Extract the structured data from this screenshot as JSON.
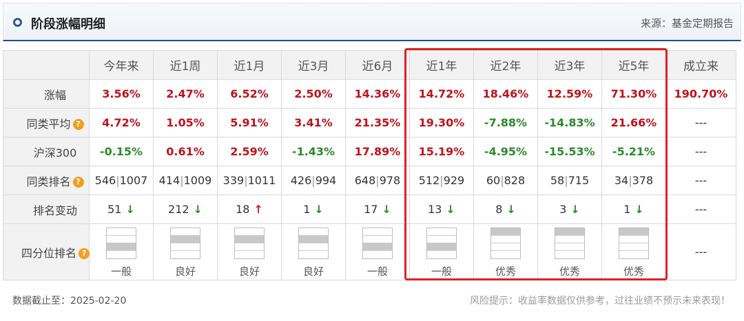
{
  "header": {
    "title": "阶段涨幅明细",
    "source": "来源：基金定期报告"
  },
  "columns": [
    "今年来",
    "近1周",
    "近1月",
    "近3月",
    "近6月",
    "近1年",
    "近2年",
    "近3年",
    "近5年",
    "成立来"
  ],
  "rows": {
    "gain": {
      "label": "涨幅",
      "values": [
        "3.56%",
        "2.47%",
        "6.52%",
        "2.50%",
        "14.36%",
        "14.72%",
        "18.46%",
        "12.59%",
        "71.30%",
        "190.70%"
      ],
      "signs": [
        "pos",
        "pos",
        "pos",
        "pos",
        "pos",
        "pos",
        "pos",
        "pos",
        "pos",
        "pos"
      ]
    },
    "peer_avg": {
      "label": "同类平均",
      "values": [
        "4.72%",
        "1.05%",
        "5.91%",
        "3.41%",
        "21.35%",
        "19.30%",
        "-7.88%",
        "-14.83%",
        "21.66%",
        "---"
      ],
      "signs": [
        "pos",
        "pos",
        "pos",
        "pos",
        "pos",
        "pos",
        "neg",
        "neg",
        "pos",
        "plain"
      ]
    },
    "hs300": {
      "label": "沪深300",
      "values": [
        "-0.15%",
        "0.61%",
        "2.59%",
        "-1.43%",
        "17.89%",
        "15.19%",
        "-4.95%",
        "-15.53%",
        "-5.21%",
        "---"
      ],
      "signs": [
        "neg",
        "pos",
        "pos",
        "neg",
        "pos",
        "pos",
        "neg",
        "neg",
        "neg",
        "plain"
      ]
    },
    "rank": {
      "label": "同类排名",
      "values": [
        [
          "546",
          "1007"
        ],
        [
          "414",
          "1009"
        ],
        [
          "339",
          "1011"
        ],
        [
          "426",
          "994"
        ],
        [
          "648",
          "978"
        ],
        [
          "512",
          "929"
        ],
        [
          "60",
          "828"
        ],
        [
          "58",
          "715"
        ],
        [
          "34",
          "378"
        ]
      ],
      "last": "---"
    },
    "rank_change": {
      "label": "排名变动",
      "values": [
        "51",
        "212",
        "18",
        "1",
        "17",
        "13",
        "8",
        "3",
        "1"
      ],
      "dirs": [
        "down",
        "down",
        "up",
        "down",
        "down",
        "down",
        "down",
        "down",
        "down"
      ],
      "arrows": {
        "up": "↑",
        "down": "↓"
      },
      "last": "---"
    },
    "quartile": {
      "label": "四分位排名",
      "values": [
        "一般",
        "良好",
        "良好",
        "良好",
        "一般",
        "一般",
        "优秀",
        "优秀",
        "优秀"
      ],
      "levels": [
        2,
        1,
        1,
        1,
        2,
        2,
        0,
        0,
        0
      ],
      "last": "---"
    }
  },
  "help_icon": "question-circle-icon",
  "help_glyph": "?",
  "footer": {
    "date": "数据截止至：2025-02-20",
    "risk": "风险提示：收益率数据仅供参考，过往业绩不预示未来表现！"
  },
  "colors": {
    "positive": "#c0121a",
    "negative": "#2a8a2a",
    "highlight": "#e02020",
    "accent": "#1e4f86"
  }
}
